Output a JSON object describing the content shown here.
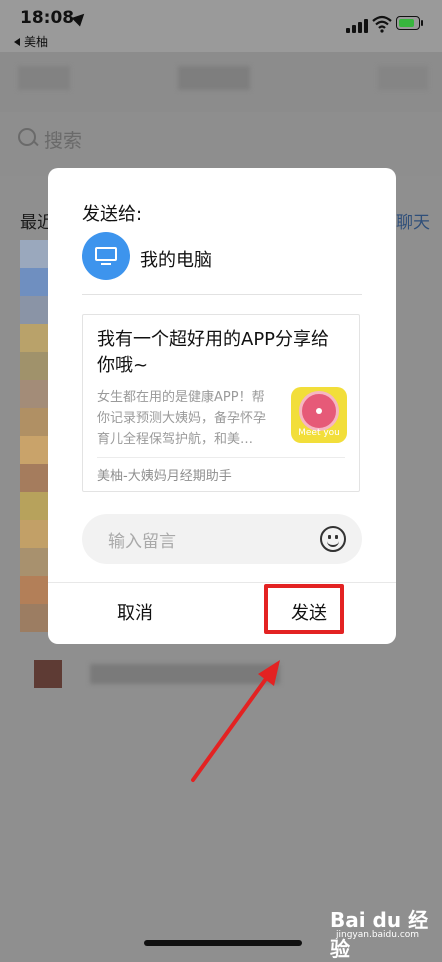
{
  "status_bar": {
    "time": "18:08",
    "back_app": "美柚",
    "icons": [
      "location-arrow-icon",
      "signal-icon",
      "wifi-icon",
      "battery-charging-icon"
    ]
  },
  "background": {
    "search_placeholder": "搜索",
    "recent_label": "最近",
    "chat_link": "聊天"
  },
  "dialog": {
    "title": "发送给:",
    "target": {
      "name": "我的电脑",
      "icon": "monitor-icon",
      "color": "#3d94ed"
    },
    "card": {
      "title": "我有一个超好用的APP分享给你哦~",
      "description": "女生都在用的是健康APP！帮你记录预测大姨妈，备孕怀孕育儿全程保驾护航，和美…",
      "thumb_text": "Meet you",
      "source": "美柚-大姨妈月经期助手"
    },
    "message_placeholder": "输入留言",
    "cancel_label": "取消",
    "send_label": "发送"
  },
  "annotations": {
    "highlight_color": "#e32222",
    "arrow_color": "#e32222"
  },
  "watermark": {
    "main": "Bai du 经验",
    "sub": "jingyan.baidu.com"
  }
}
